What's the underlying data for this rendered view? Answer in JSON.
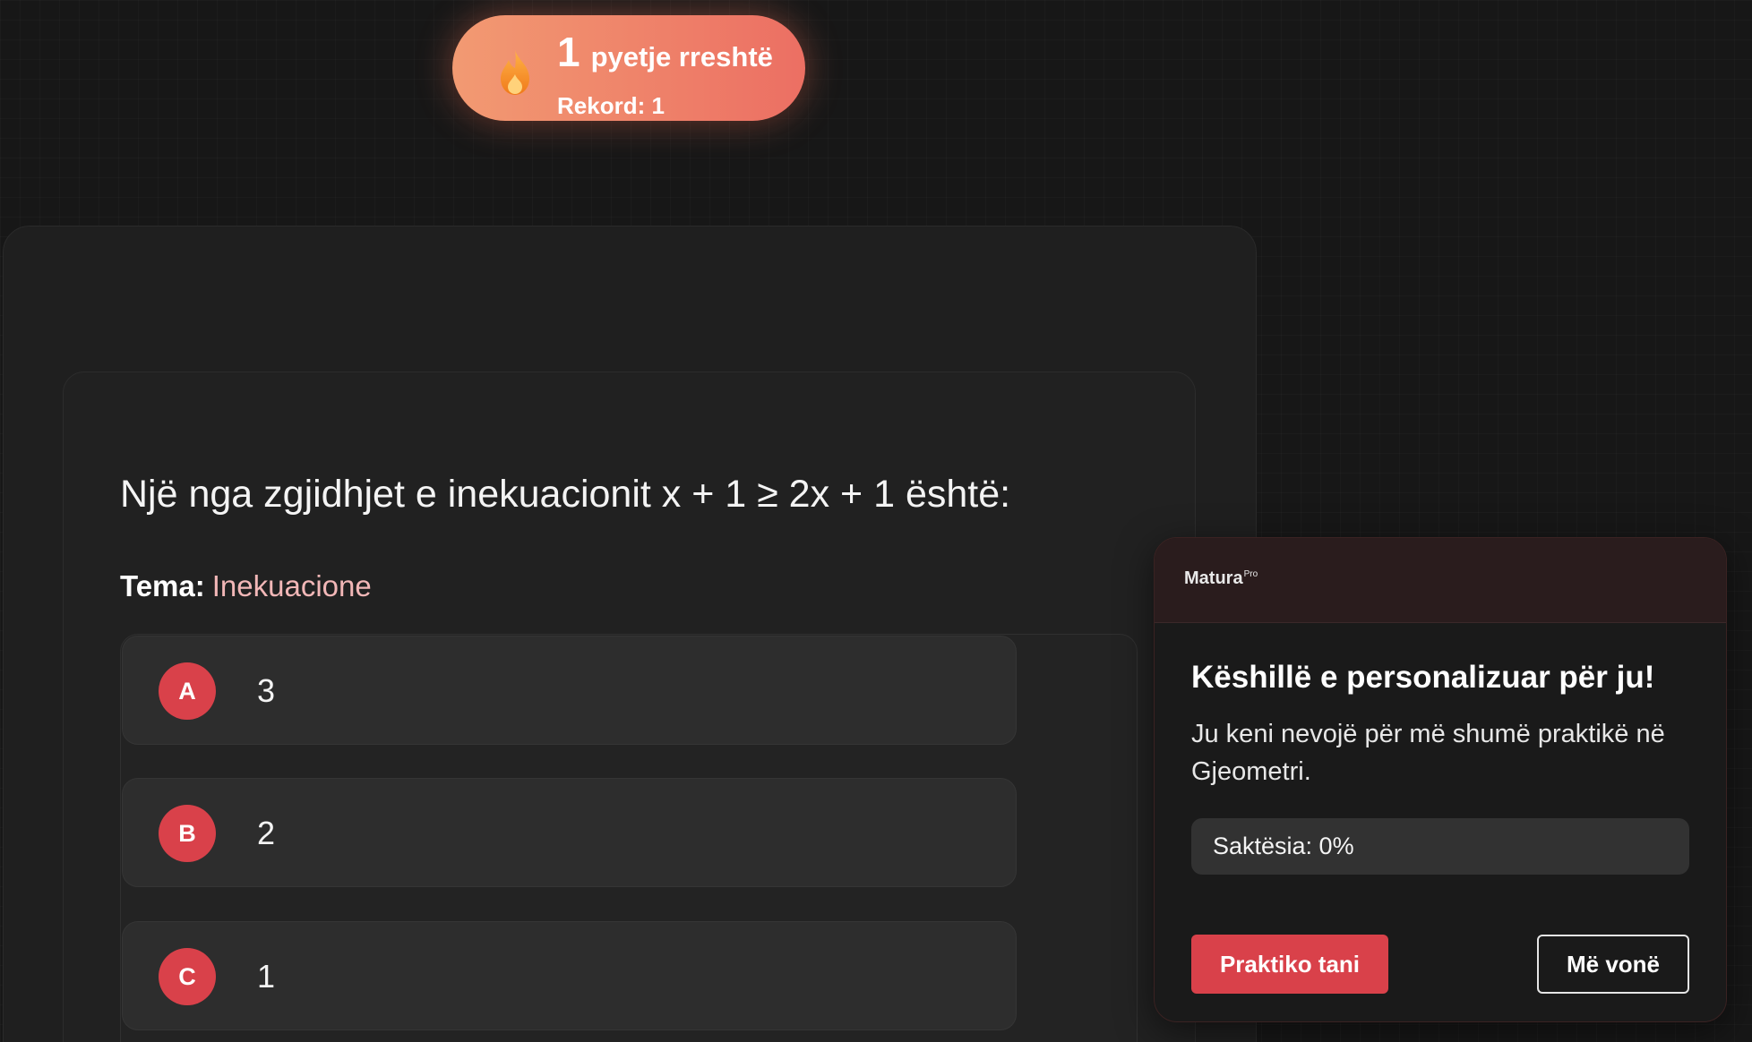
{
  "streak": {
    "count": "1",
    "label": "pyetje rreshtë",
    "record": "Rekord: 1",
    "icon": "flame-icon"
  },
  "question": {
    "text": "Një nga zgjidhjet e inekuacionit x + 1 ≥ 2x + 1 është:",
    "topic_label": "Tema:",
    "topic_value": "Inekuacione"
  },
  "answers": [
    {
      "letter": "A",
      "value": "3"
    },
    {
      "letter": "B",
      "value": "2"
    },
    {
      "letter": "C",
      "value": "1"
    }
  ],
  "popup": {
    "brand": "Matura",
    "brand_sup": "Pro",
    "title": "Këshillë e personalizuar për ju!",
    "message": "Ju keni nevojë për më shumë praktikë në Gjeometri.",
    "accuracy_text": "Saktësia: 0%",
    "accuracy_value": 0,
    "practice_button": "Praktiko tani",
    "later_button": "Më vonë"
  },
  "colors": {
    "accent": "#d9414a",
    "streak_start": "#f29a72",
    "streak_end": "#ec6f63",
    "topic": "#f2b7b7"
  }
}
